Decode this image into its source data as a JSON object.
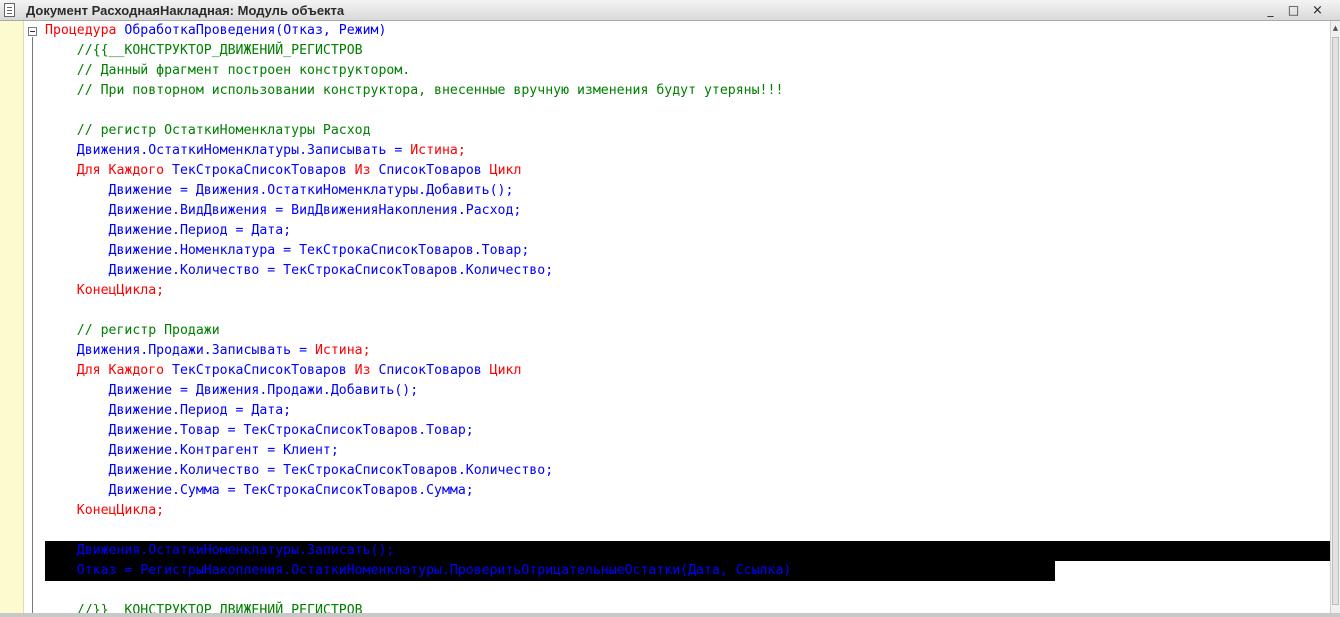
{
  "window": {
    "title": "Документ РасходнаяНакладная: Модуль объекта",
    "icon": "document-icon"
  },
  "window_buttons": {
    "minimize": "_",
    "maximize": "□",
    "close": "×"
  },
  "colors": {
    "keyword": "#ff0000",
    "identifier": "#0000ff",
    "comment": "#008000",
    "selection_bg": "#000000",
    "selection_fg": "#ffff80",
    "gutter": "#fcfbd0"
  },
  "code": {
    "l1_kw": "Процедура",
    "l1_id": " ОбработкаПроведения(Отказ, Режим)",
    "l2": "    //{{__КОНСТРУКТОР_ДВИЖЕНИЙ_РЕГИСТРОВ",
    "l3": "    // Данный фрагмент построен конструктором.",
    "l4": "    // При повторном использовании конструктора, внесенные вручную изменения будут утеряны!!!",
    "l6": "    // регистр ОстаткиНоменклатуры Расход",
    "l7_id": "    Движения.ОстаткиНоменклатуры.Записывать = ",
    "l7_kw": "Истина;",
    "l8_kw1": "    Для Каждого",
    "l8_id1": " ТекСтрокаСписокТоваров ",
    "l8_kw2": "Из",
    "l8_id2": " СписокТоваров ",
    "l8_kw3": "Цикл",
    "l9": "        Движение = Движения.ОстаткиНоменклатуры.Добавить();",
    "l10": "        Движение.ВидДвижения = ВидДвиженияНакопления.Расход;",
    "l11": "        Движение.Период = Дата;",
    "l12": "        Движение.Номенклатура = ТекСтрокаСписокТоваров.Товар;",
    "l13": "        Движение.Количество = ТекСтрокаСписокТоваров.Количество;",
    "l14": "    КонецЦикла;",
    "l16": "    // регистр Продажи",
    "l17_id": "    Движения.Продажи.Записывать = ",
    "l17_kw": "Истина;",
    "l18_kw1": "    Для Каждого",
    "l18_id1": " ТекСтрокаСписокТоваров ",
    "l18_kw2": "Из",
    "l18_id2": " СписокТоваров ",
    "l18_kw3": "Цикл",
    "l19": "        Движение = Движения.Продажи.Добавить();",
    "l20": "        Движение.Период = Дата;",
    "l21": "        Движение.Товар = ТекСтрокаСписокТоваров.Товар;",
    "l22": "        Движение.Контрагент = Клиент;",
    "l23": "        Движение.Количество = ТекСтрокаСписокТоваров.Количество;",
    "l24": "        Движение.Сумма = ТекСтрокаСписокТоваров.Сумма;",
    "l25": "    КонецЦикла;",
    "l27": "    Движения.ОстаткиНоменклатуры.Записать();",
    "l28": "    Отказ = РегистрыНакопления.ОстаткиНоменклатуры.ПроверитьОтрицательныеОстатки(Дата, Ссылка)",
    "l30": "    //}}__КОНСТРУКТОР_ДВИЖЕНИЙ_РЕГИСТРОВ"
  }
}
